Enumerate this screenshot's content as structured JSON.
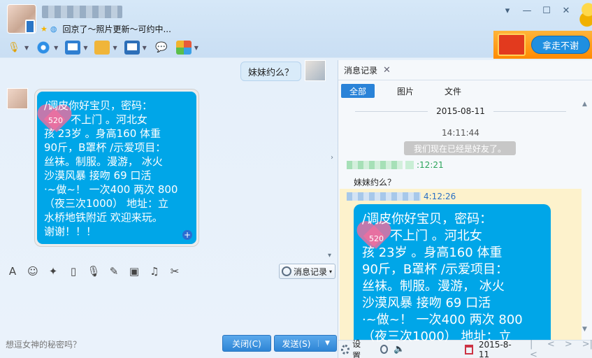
{
  "header": {
    "status_text": "回京了～照片更新～可约中...",
    "window_controls": [
      "▾",
      "—",
      "☐",
      "✕"
    ]
  },
  "toolbar": {
    "items": [
      "mic-icon",
      "camera-icon",
      "screen-share-icon",
      "file-transfer-icon",
      "remote-desktop-icon",
      "message-icon",
      "apps-icon"
    ]
  },
  "promo": {
    "button_label": "拿走不谢"
  },
  "chat": {
    "outgoing_message": "妹妹约么？",
    "heart_label": "520",
    "incoming_message": "/调皮你好宝贝，密码：\n        不上门 。河北女\n孩 23岁 。身高160 体重\n90斤，B罩杯 /示爱项目：\n丝袜。制服。漫游， 冰火\n沙漠风暴 接吻 69 口活\n·~做~！ 一次400 两次 800\n（夜三次1000） 地址：立\n水桥地铁附近 欢迎来玩。\n谢谢！！！"
  },
  "input": {
    "history_button": "消息记录",
    "placeholder": "想逗女神的秘密吗？",
    "close_button": "关闭(C)",
    "send_button": "发送(S)"
  },
  "history": {
    "tab_label": "消息记录",
    "filters": [
      "全部",
      "图片",
      "文件"
    ],
    "date": "2015-08-11",
    "system_time": "14:11:44",
    "system_message": "我们现在已经是好友了。",
    "message1_time_suffix": ":12:21",
    "message1_text": "妹妹约么？",
    "message2_time_suffix": "4:12:26",
    "heart_label": "520",
    "message2_text": "/调皮你好宝贝，密码：\n       不上门 。河北女\n孩 23岁 。身高160 体重\n90斤，B罩杯 /示爱项目：\n丝袜。制服。漫游， 冰火\n沙漠风暴 接吻 69 口活\n·~做~！ 一次400 两次 800\n（夜三次1000） 地址：立",
    "settings_label": "设置",
    "bottom_date": "2015-8-11",
    "pager": [
      "|<",
      "<",
      ">",
      ">|"
    ]
  }
}
